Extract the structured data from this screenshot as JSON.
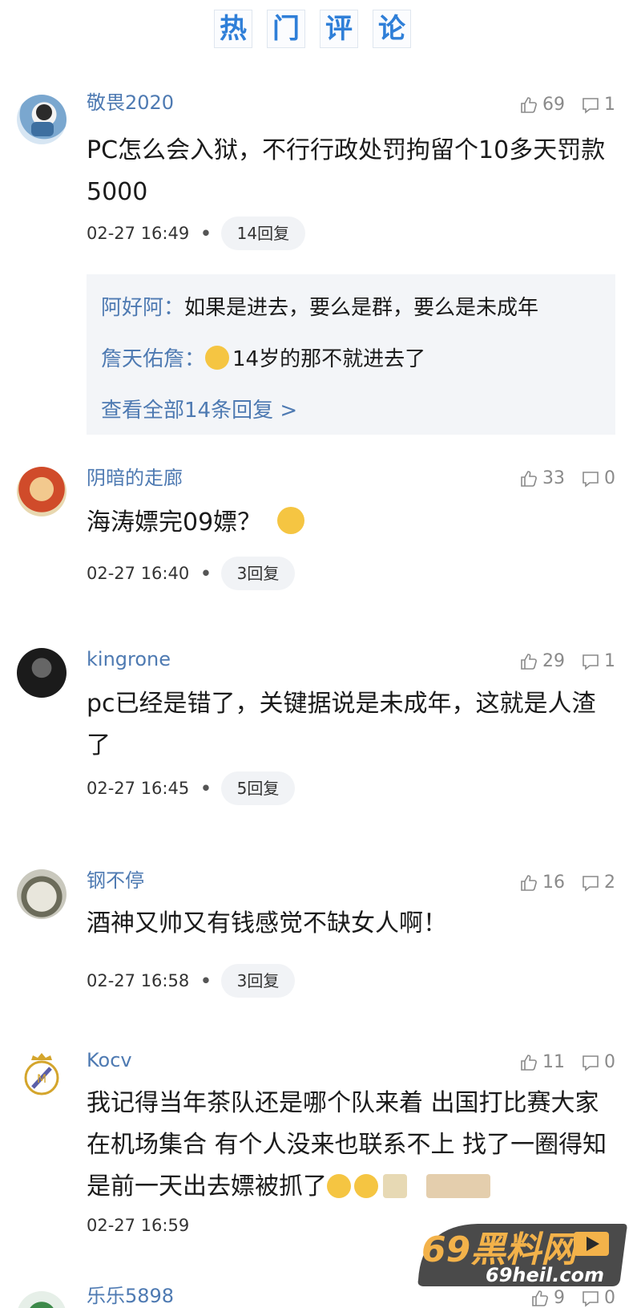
{
  "header": {
    "chars": [
      "热",
      "门",
      "评",
      "论"
    ]
  },
  "colors": {
    "accent": "#2f7fd8",
    "username": "#4e7ab2",
    "meta": "#8a8a8a",
    "reply_bg": "#f3f5f8"
  },
  "comments": [
    {
      "username": "敬畏2020",
      "likes": "69",
      "replies_count": "1",
      "text": "PC怎么会入狱，不行行政处罚拘留个10多天罚款5000",
      "time": "02-27 16:49",
      "reply_label": "14回复",
      "reply_preview": [
        {
          "name": "阿好阿：",
          "text": "如果是进去，要么是群，要么是未成年"
        },
        {
          "name": "詹天佑詹：",
          "text": "14岁的那不就进去了"
        }
      ],
      "view_all": "查看全部14条回复 >"
    },
    {
      "username": "阴暗的走廊",
      "likes": "33",
      "replies_count": "0",
      "text": "海涛嫖完09嫖？",
      "time": "02-27 16:40",
      "reply_label": "3回复"
    },
    {
      "username": "kingrone",
      "likes": "29",
      "replies_count": "1",
      "text": "pc已经是错了，关键据说是未成年，这就是人渣了",
      "time": "02-27 16:45",
      "reply_label": "5回复"
    },
    {
      "username": "钢不停",
      "likes": "16",
      "replies_count": "2",
      "text": "酒神又帅又有钱感觉不缺女人啊！",
      "time": "02-27 16:58",
      "reply_label": "3回复"
    },
    {
      "username": "Kocv",
      "likes": "11",
      "replies_count": "0",
      "text": "我记得当年茶队还是哪个队来着 出国打比赛大家在机场集合 有个人没来也联系不上 找了一圈得知是前一天出去嫖被抓了",
      "time": "02-27 16:59"
    },
    {
      "username": "乐乐5898",
      "likes": "9",
      "replies_count": "0"
    }
  ],
  "watermark": {
    "main": "69黑料网",
    "sub": "69heil.com"
  }
}
